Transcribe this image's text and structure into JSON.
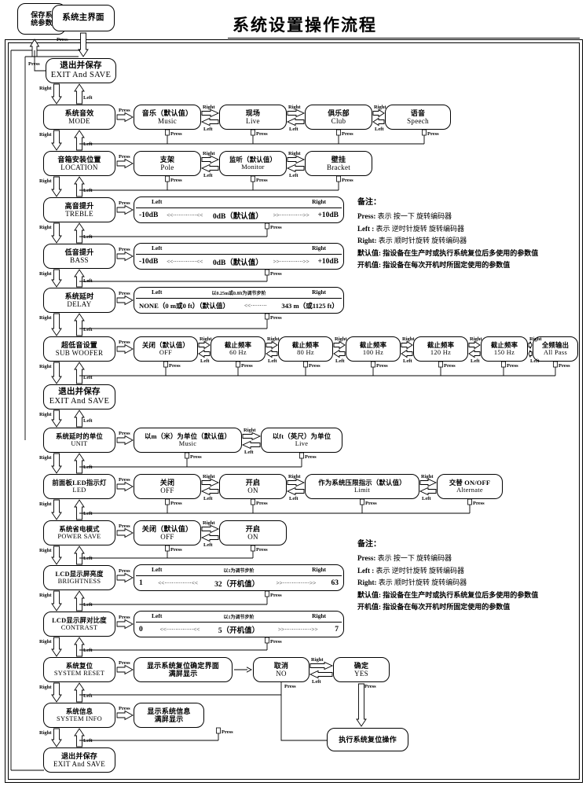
{
  "title": "系统设置操作流程",
  "legend": {
    "press": "Press",
    "left": "Left",
    "right": "Right"
  },
  "top": {
    "save_params": {
      "cn": "保存系\n统参数",
      "cn_l1": "保存系",
      "cn_l2": "统参数"
    },
    "main_ui": {
      "cn": "系统主界面"
    },
    "exit_save_top": {
      "cn": "退出并保存",
      "en": "EXIT And SAVE"
    }
  },
  "rows": [
    {
      "key": "mode",
      "menu": {
        "cn": "系统音效",
        "en": "MODE"
      },
      "options": [
        {
          "cn": "音乐（默认值）",
          "en": "Music"
        },
        {
          "cn": "现场",
          "en": "Live"
        },
        {
          "cn": "俱乐部",
          "en": "Club"
        },
        {
          "cn": "语音",
          "en": "Speech"
        }
      ]
    },
    {
      "key": "location",
      "menu": {
        "cn": "音箱安装位置",
        "en": "LOCATION"
      },
      "options": [
        {
          "cn": "支架",
          "en": "Pole"
        },
        {
          "cn": "监听（默认值）",
          "en": "Monitor"
        },
        {
          "cn": "壁挂",
          "en": "Bracket"
        }
      ]
    },
    {
      "key": "treble",
      "menu": {
        "cn": "高音提升",
        "en": "TREBLE"
      },
      "range": {
        "left_tag": "Left",
        "right_tag": "Right",
        "step_note": "",
        "min": "-10dB",
        "mid": "0dB（默认值）",
        "max": "+10dB",
        "dots_left": "<<·············<<",
        "dots_right": ">>·············>>"
      }
    },
    {
      "key": "bass",
      "menu": {
        "cn": "低音提升",
        "en": "BASS"
      },
      "range": {
        "left_tag": "Left",
        "right_tag": "Right",
        "step_note": "",
        "min": "-10dB",
        "mid": "0dB（默认值）",
        "max": "+10dB",
        "dots_left": "<<·············<<",
        "dots_right": ">>·············>>"
      }
    },
    {
      "key": "delay",
      "menu": {
        "cn": "系统延时",
        "en": "DELAY"
      },
      "range": {
        "left_tag": "Left",
        "right_tag": "Right",
        "step_note": "以0.25m或0.8ft为调节步阶",
        "min": "NONE（0 m或0 ft）（默认值）",
        "mid": "",
        "max": "343 m（或1125 ft）",
        "dots_left": "<<·········",
        "dots_right": ">>"
      }
    },
    {
      "key": "subwoofer",
      "menu": {
        "cn": "超低音设置",
        "en": "SUB WOOFER"
      },
      "options": [
        {
          "cn": "关闭（默认值）",
          "en": "OFF"
        },
        {
          "cn": "截止频率",
          "en": "60 Hz"
        },
        {
          "cn": "截止频率",
          "en": "80 Hz"
        },
        {
          "cn": "截止频率",
          "en": "100 Hz"
        },
        {
          "cn": "截止频率",
          "en": "120 Hz"
        },
        {
          "cn": "截止频率",
          "en": "150 Hz"
        },
        {
          "cn": "全频输出",
          "en": "All Pass"
        }
      ]
    }
  ],
  "exit_save_mid": {
    "cn": "退出并保存",
    "en": "EXIT And SAVE"
  },
  "rows2": [
    {
      "key": "unit",
      "menu": {
        "cn": "系统延时的单位",
        "en": "UNIT"
      },
      "options": [
        {
          "cn": "以m（米）为单位（默认值）",
          "en": "Music"
        },
        {
          "cn": "以ft（英尺）为单位",
          "en": "Live"
        }
      ]
    },
    {
      "key": "led",
      "menu": {
        "cn": "前面板LED指示灯",
        "en": "LED"
      },
      "options": [
        {
          "cn": "关闭",
          "en": "OFF"
        },
        {
          "cn": "开启",
          "en": "ON"
        },
        {
          "cn": "作为系统压限指示（默认值）",
          "en": "Limit"
        },
        {
          "cn": "交替 ON/OFF",
          "en": "Alternate"
        }
      ]
    },
    {
      "key": "powersave",
      "menu": {
        "cn": "系统省电模式",
        "en": "POWER SAVE"
      },
      "options": [
        {
          "cn": "关闭（默认值）",
          "en": "OFF"
        },
        {
          "cn": "开启",
          "en": "ON"
        }
      ]
    },
    {
      "key": "brightness",
      "menu": {
        "cn": "LCD显示屏亮度",
        "en": "BRIGHTNESS"
      },
      "range": {
        "left_tag": "Left",
        "right_tag": "Right",
        "step_note": "以1为调节步阶",
        "min": "1",
        "mid": "32（开机值）",
        "max": "63",
        "dots_left": "<<···············<<",
        "dots_right": ">>···············>>"
      }
    },
    {
      "key": "contrast",
      "menu": {
        "cn": "LCD显示屏对比度",
        "en": "CONTRAST"
      },
      "range": {
        "left_tag": "Left",
        "right_tag": "Right",
        "step_note": "以1为调节步阶",
        "min": "0",
        "mid": "5（开机值）",
        "max": "7",
        "dots_left": "<<···············<<",
        "dots_right": ">>···············>>"
      }
    },
    {
      "key": "reset",
      "menu": {
        "cn": "系统复位",
        "en": "SYSTEM RESET"
      },
      "screen": {
        "cn1": "显示系统复位确定界面",
        "cn2": "满屏显示"
      },
      "confirm": [
        {
          "cn": "取消",
          "en": "NO"
        },
        {
          "cn": "确定",
          "en": "YES"
        }
      ],
      "action": {
        "cn": "执行系统复位操作"
      }
    },
    {
      "key": "info",
      "menu": {
        "cn": "系统信息",
        "en": "SYSTEM INFO"
      },
      "screen": {
        "cn1": "显示系统信息",
        "cn2": "满屏显示"
      }
    }
  ],
  "exit_save_bottom": {
    "cn": "退出并保存",
    "en": "EXIT And SAVE"
  },
  "notes": {
    "heading": "备注：",
    "lines": [
      {
        "k": "Press:",
        "v": "表示 按一下 旋转编码器"
      },
      {
        "k": "Left :",
        "v": "表示 逆时针旋转 旋转编码器"
      },
      {
        "k": "Right:",
        "v": "表示 顺时针旋转 旋转编码器"
      }
    ],
    "cn_lines": [
      "默认值: 指设备在生产时或执行系统复位后多使用的参数值",
      "开机值: 指设备在每次开机时所固定使用的参数值"
    ]
  }
}
